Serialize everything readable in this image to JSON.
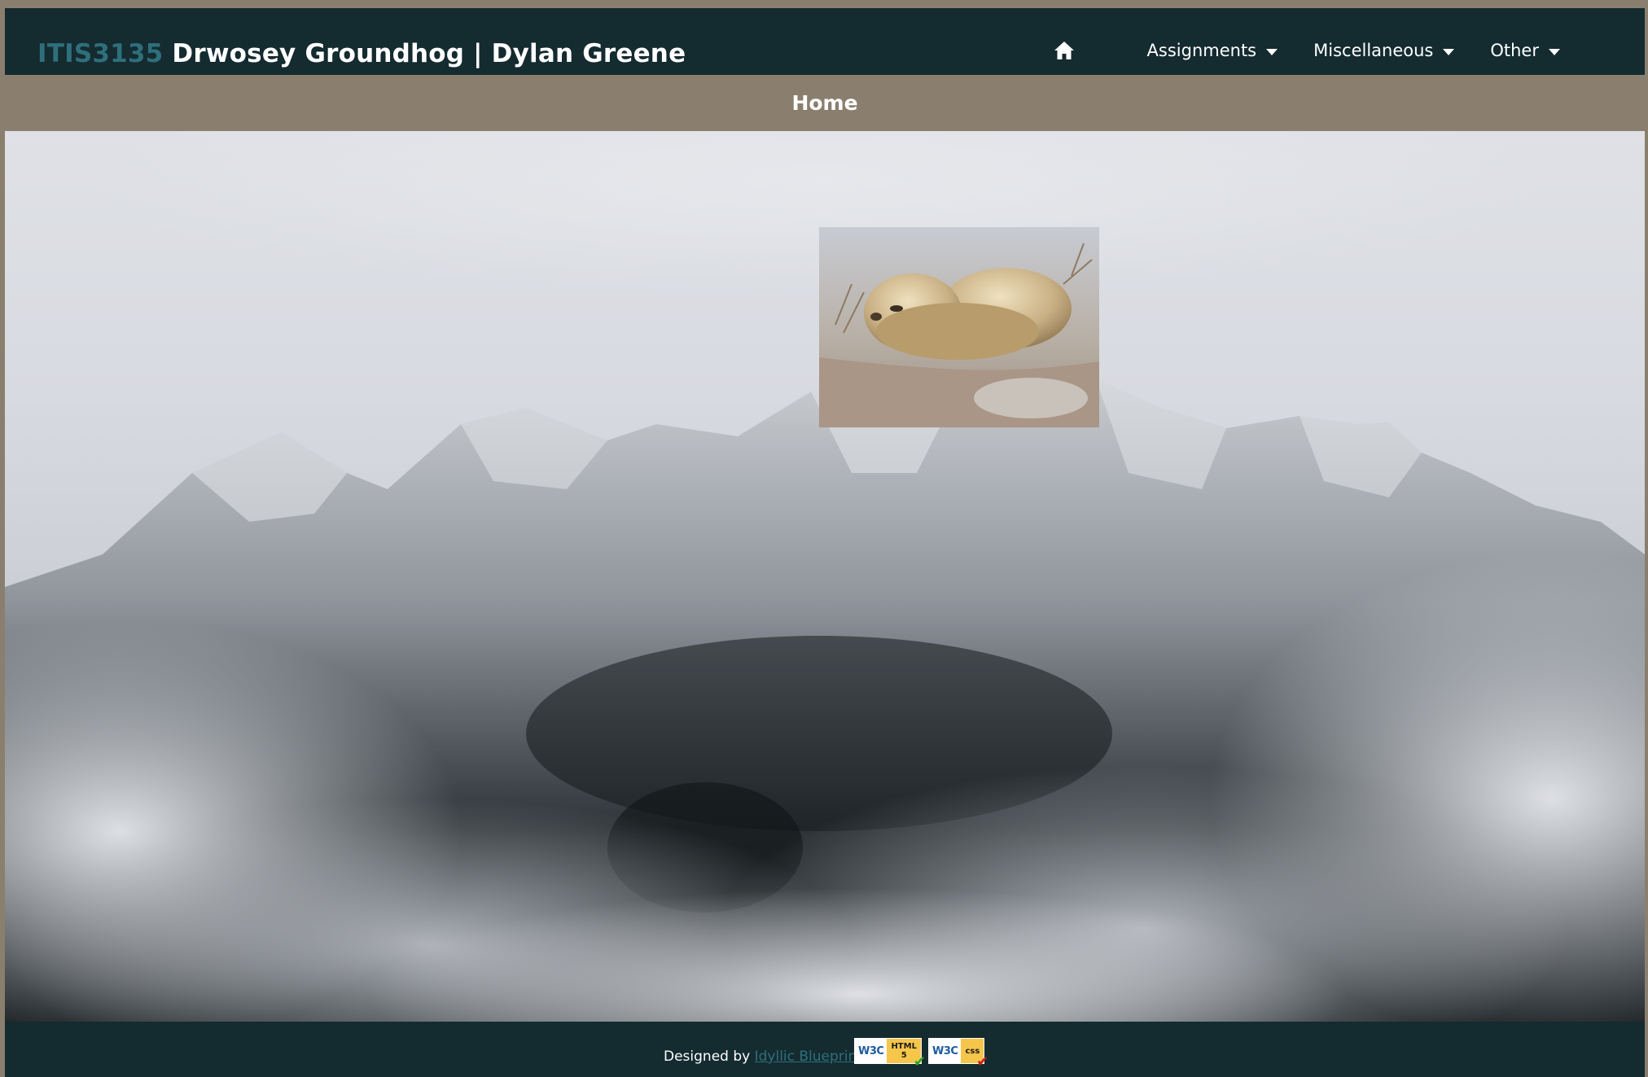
{
  "header": {
    "course_code": "ITIS3135",
    "site_title": "Drwosey Groundhog | Dylan Greene"
  },
  "nav": {
    "home_icon": "home-icon",
    "items": [
      {
        "label": "Assignments",
        "icon": "caret-down-icon"
      },
      {
        "label": "Miscellaneous",
        "icon": "caret-down-icon"
      },
      {
        "label": "Other",
        "icon": "caret-down-icon"
      }
    ]
  },
  "page": {
    "heading": "Home"
  },
  "hero": {
    "background": "mountain-in-clouds-image",
    "overlay_image": "groundhog-photo"
  },
  "footer": {
    "designed_by": "Designed by",
    "designer_link": "Idyllic Blueprint",
    "badges": [
      {
        "org": "W3C",
        "kind": "HTML",
        "version": "5"
      },
      {
        "org": "W3C",
        "kind": "css"
      }
    ]
  },
  "colors": {
    "header_bg": "#142b30",
    "accent_teal": "#2f6f7c",
    "subbar_bg": "#8a7f6e"
  }
}
